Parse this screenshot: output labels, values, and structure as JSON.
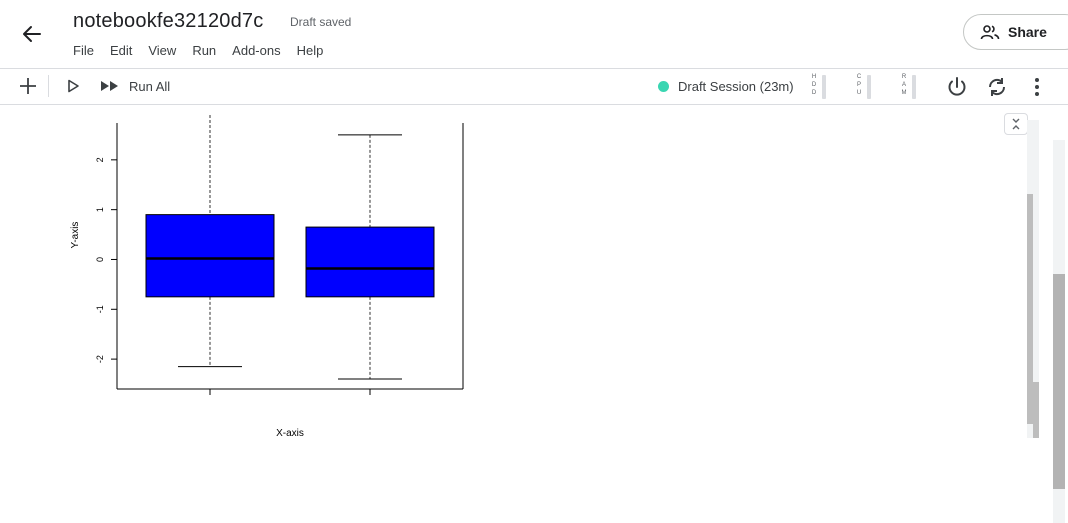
{
  "header": {
    "title": "notebookfe32120d7c",
    "status": "Draft saved",
    "menu": [
      "File",
      "Edit",
      "View",
      "Run",
      "Add-ons",
      "Help"
    ],
    "share_label": "Share"
  },
  "toolbar": {
    "run_all_label": "Run All",
    "session_label": "Draft Session (23m)",
    "session_color": "#3ad6b2",
    "resources": [
      {
        "name": "HDD",
        "letters": "H D D"
      },
      {
        "name": "CPU",
        "letters": "C P U"
      },
      {
        "name": "RAM",
        "letters": "R A M"
      }
    ]
  },
  "chart_data": {
    "type": "boxplot",
    "xlabel": "X-axis",
    "ylabel": "Y-axis",
    "ylim": [
      -2.6,
      2.9
    ],
    "yticks": [
      "-2",
      "-1",
      "0",
      "1",
      "2"
    ],
    "fill_color": "#0000ff",
    "boxes": [
      {
        "min": -2.15,
        "q1": -0.75,
        "median": 0.02,
        "q3": 0.9,
        "max": 2.9
      },
      {
        "min": -2.4,
        "q1": -0.75,
        "median": -0.18,
        "q3": 0.65,
        "max": 2.5
      }
    ]
  }
}
